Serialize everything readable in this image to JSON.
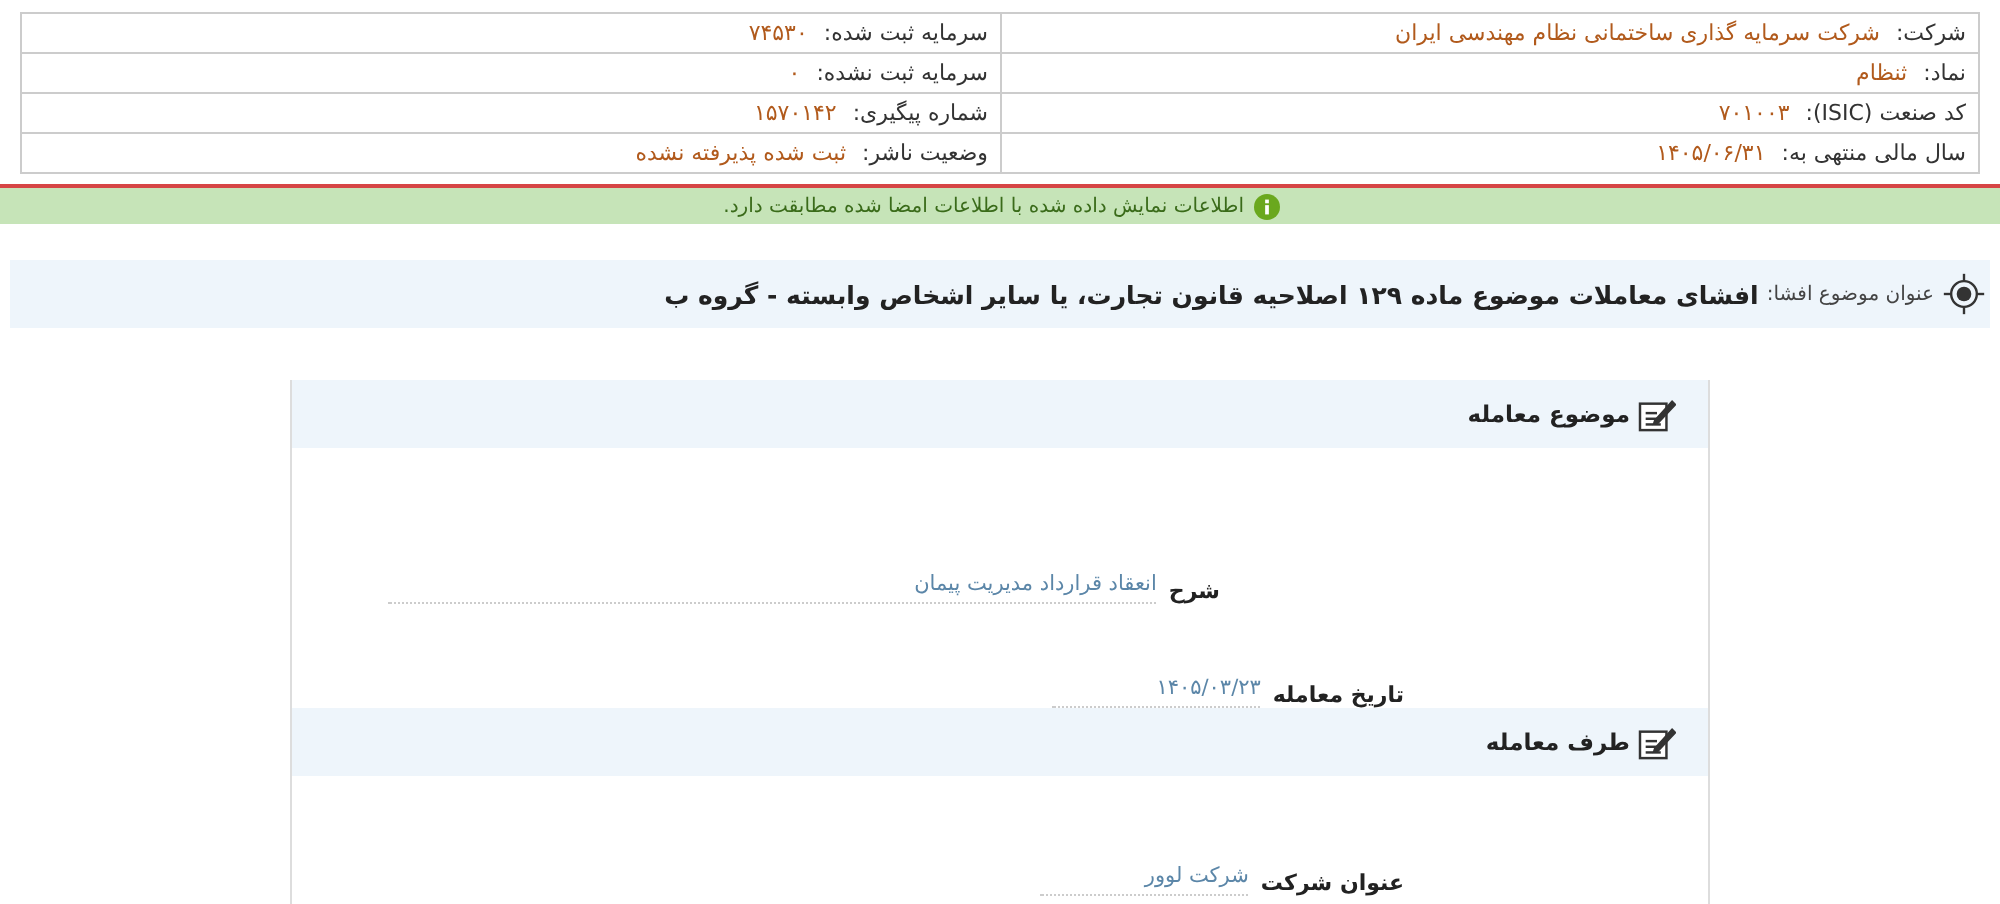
{
  "info": [
    {
      "label": "شرکت:",
      "value": "شرکت سرمایه گذاری ساختمانی نظام مهندسی ایران"
    },
    {
      "label": "سرمایه ثبت شده:",
      "value": "۷۴۵۳۰"
    },
    {
      "label": "نماد:",
      "value": "ثنظام"
    },
    {
      "label": "سرمایه ثبت نشده:",
      "value": "۰"
    },
    {
      "label": "کد صنعت (ISIC):",
      "value": "۷۰۱۰۰۳"
    },
    {
      "label": "شماره پیگیری:",
      "value": "۱۵۷۰۱۴۲"
    },
    {
      "label": "سال مالی منتهی به:",
      "value": "۱۴۰۵/۰۶/۳۱"
    },
    {
      "label": "وضعیت ناشر:",
      "value": "ثبت شده پذیرفته نشده"
    }
  ],
  "notice": {
    "text": "اطلاعات نمایش داده شده با اطلاعات امضا شده مطابقت دارد."
  },
  "subject": {
    "label": "عنوان موضوع افشا:",
    "value": "افشای معاملات موضوع ماده ۱۲۹ اصلاحیه قانون تجارت، یا سایر اشخاص وابسته - گروه ب"
  },
  "sections": [
    {
      "title": "موضوع معامله",
      "fields": [
        {
          "kind": "long",
          "label": "شرح",
          "value": "انعقاد قرارداد مدیریت پیمان"
        },
        {
          "kind": "short",
          "label": "تاریخ معامله",
          "value": "۱۴۰۵/۰۳/۲۳"
        }
      ]
    },
    {
      "title": "طرف معامله",
      "fields": [
        {
          "kind": "short",
          "label": "عنوان شرکت",
          "value": "شرکت لوور"
        }
      ]
    }
  ]
}
